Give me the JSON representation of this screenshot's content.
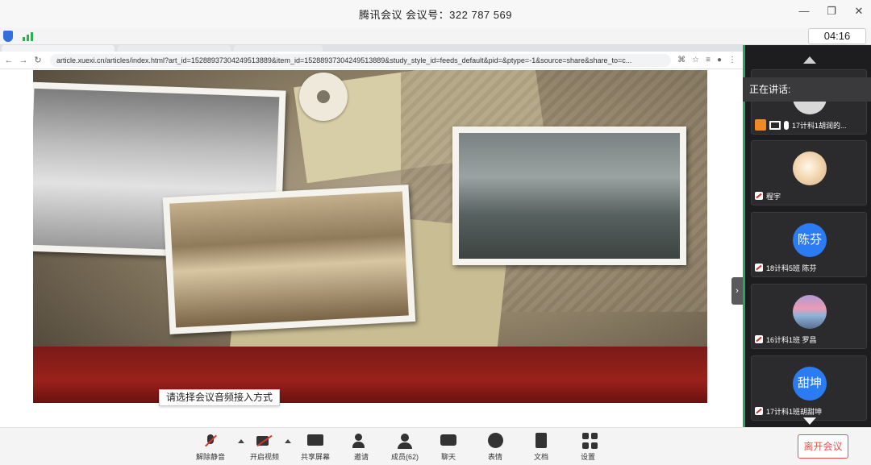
{
  "window": {
    "title": "腾讯会议 会议号：322 787 569",
    "minimize": "—",
    "restore": "❐",
    "close": "✕"
  },
  "status": {
    "timer": "04:16"
  },
  "browser": {
    "url": "article.xuexi.cn/articles/index.html?art_id=15288937304249513889&item_id=15288937304249513889&study_style_id=feeds_default&pid=&ptype=-1&source=share&share_to=c..."
  },
  "audio_tip": "请选择会议音频接入方式",
  "panel": {
    "speaking_label": "正在讲话:",
    "participants": [
      {
        "label": "17计科1胡润的...",
        "avatar_text": ""
      },
      {
        "label": "程宇",
        "avatar_text": ""
      },
      {
        "label": "18计科5班 陈芬",
        "avatar_text": "陈芬"
      },
      {
        "label": "16计科1班 罗昌",
        "avatar_text": ""
      },
      {
        "label": "17计科1班胡甜坤",
        "avatar_text": "甜坤"
      }
    ]
  },
  "toolbar": {
    "unmute": "解除静音",
    "start_video": "开启视频",
    "share_screen": "共享屏幕",
    "invite": "邀请",
    "members": "成员(62)",
    "chat": "聊天",
    "emoji": "表情",
    "docs": "文档",
    "settings": "设置",
    "leave": "离开会议"
  },
  "colors": {
    "accent_green": "#2aa45a",
    "leave_red": "#e5534b",
    "avatar_blue": "#2b7cf2"
  }
}
